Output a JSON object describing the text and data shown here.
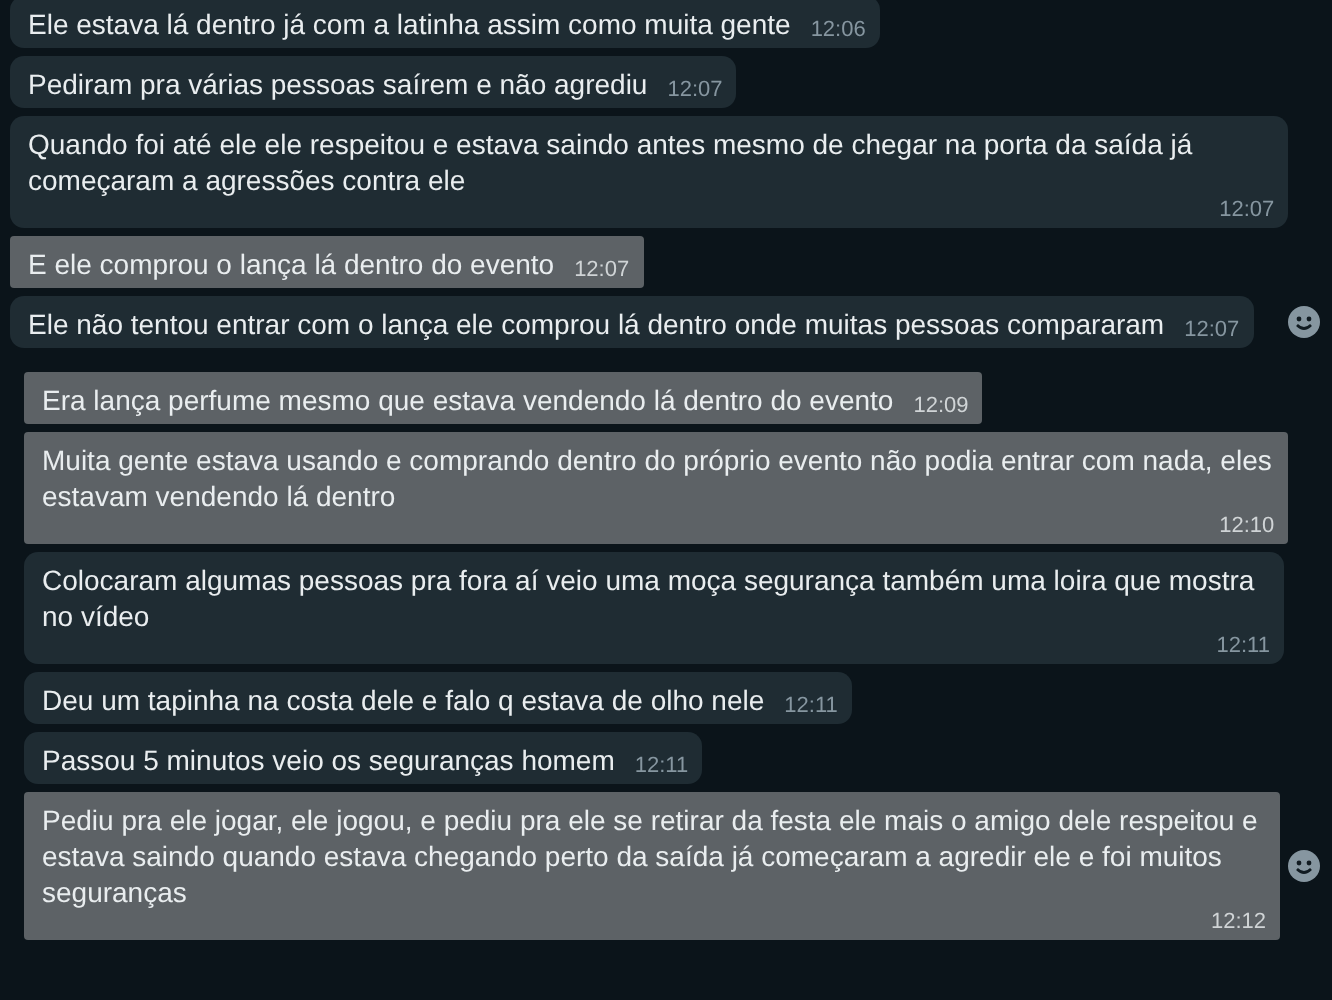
{
  "groups": [
    {
      "messages": [
        {
          "text": "Ele estava lá dentro já com a latinha assim como muita gente",
          "time": "12:06",
          "selected": false
        },
        {
          "text": "Pediram pra várias pessoas saírem e não agrediu",
          "time": "12:07",
          "selected": false
        },
        {
          "text": "Quando foi até ele ele respeitou e estava saindo antes mesmo de chegar na porta da saída já começaram a agressões contra ele",
          "time": "12:07",
          "selected": false
        },
        {
          "text": "E ele comprou o lança lá dentro do evento",
          "time": "12:07",
          "selected": true
        },
        {
          "text": "Ele não tentou entrar com o lança ele comprou lá dentro onde muitas pessoas compararam",
          "time": "12:07",
          "selected": false,
          "reaction_icon": true
        }
      ]
    },
    {
      "messages": [
        {
          "text": "Era lança perfume mesmo que estava vendendo lá dentro do evento",
          "time": "12:09",
          "selected": true
        },
        {
          "text": "Muita gente estava usando e comprando dentro do próprio evento não podia entrar com nada, eles estavam vendendo lá dentro",
          "time": "12:10",
          "selected": true
        },
        {
          "text": "Colocaram algumas pessoas pra fora aí veio uma moça segurança também uma loira que mostra no vídeo",
          "time": "12:11",
          "selected": false
        },
        {
          "text": "Deu um tapinha na costa dele e falo q estava de olho nele",
          "time": "12:11",
          "selected": false
        },
        {
          "text": "Passou 5 minutos veio os seguranças homem",
          "time": "12:11",
          "selected": false
        },
        {
          "text": "Pediu pra ele jogar, ele jogou, e pediu pra ele se retirar da festa ele mais o amigo dele respeitou e estava saindo quando estava chegando perto da saída já começaram a agredir ele e foi muitos seguranças",
          "time": "12:12",
          "selected": true,
          "reaction_icon": true
        }
      ]
    }
  ]
}
